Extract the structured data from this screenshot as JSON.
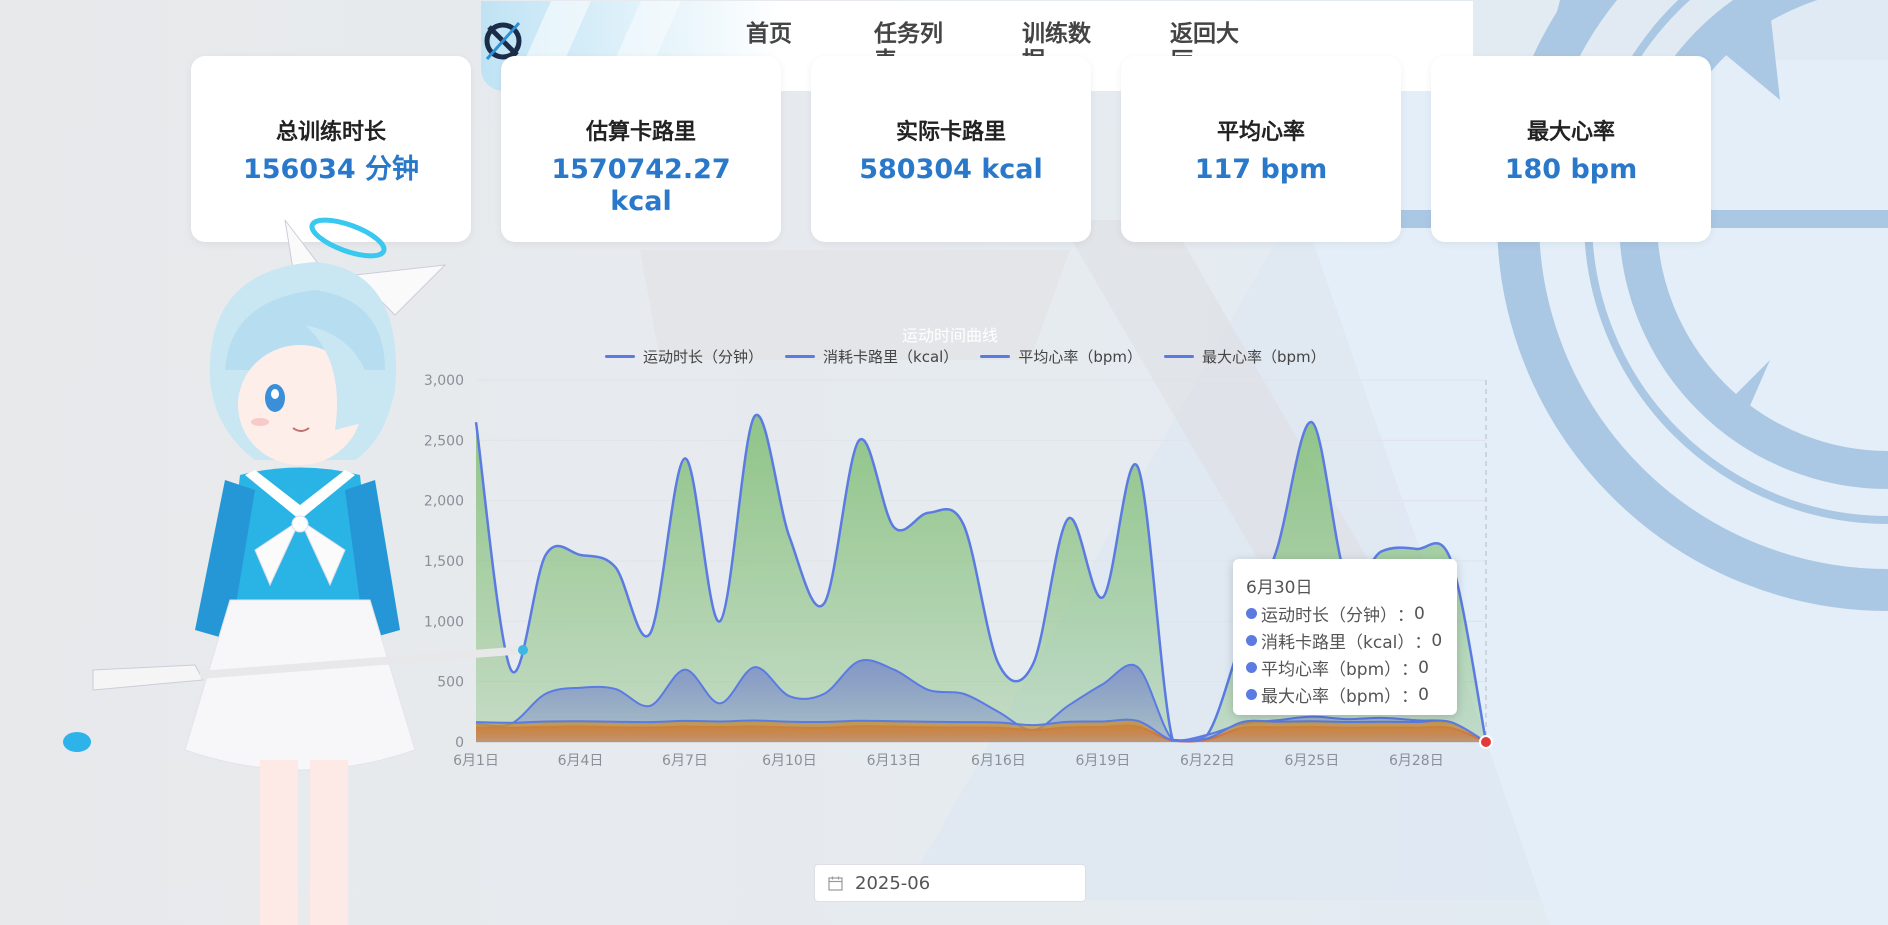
{
  "nav": {
    "items": [
      "首页",
      "任务列表",
      "训练数据",
      "返回大厅"
    ]
  },
  "stats": [
    {
      "title": "总训练时长",
      "value": "156034 分钟"
    },
    {
      "title": "估算卡路里",
      "value": "1570742.27 kcal"
    },
    {
      "title": "实际卡路里",
      "value": "580304 kcal"
    },
    {
      "title": "平均心率",
      "value": "117 bpm"
    },
    {
      "title": "最大心率",
      "value": "180 bpm"
    }
  ],
  "chart_data": {
    "type": "area",
    "title": "运动时间曲线",
    "legend_position": "top",
    "x_ticks": [
      "6月1日",
      "6月4日",
      "6月7日",
      "6月10日",
      "6月13日",
      "6月16日",
      "6月19日",
      "6月22日",
      "6月25日",
      "6月28日"
    ],
    "ylim": [
      0,
      3000
    ],
    "y_ticks": [
      "0",
      "500",
      "1,000",
      "1,500",
      "2,000",
      "2,500",
      "3,000"
    ],
    "x": [
      1,
      2,
      3,
      4,
      5,
      6,
      7,
      8,
      9,
      10,
      11,
      12,
      13,
      14,
      15,
      16,
      17,
      18,
      19,
      20,
      21,
      22,
      23,
      24,
      25,
      26,
      27,
      28,
      29,
      30
    ],
    "series": [
      {
        "name": "运动时长（分钟）",
        "color": "#5b7be3",
        "fill": "#86c07c",
        "values": [
          2650,
          600,
          1550,
          1550,
          1450,
          900,
          2350,
          1000,
          2700,
          1700,
          1150,
          2500,
          1780,
          1900,
          1800,
          650,
          650,
          1850,
          1200,
          2280,
          20,
          60,
          860,
          1600,
          2650,
          1350,
          1580,
          1600,
          1500,
          0
        ]
      },
      {
        "name": "消耗卡路里（kcal）",
        "color": "#5b7be3",
        "fill": "#7d8fc9",
        "values": [
          150,
          150,
          400,
          450,
          440,
          300,
          600,
          320,
          620,
          380,
          400,
          670,
          600,
          430,
          400,
          250,
          100,
          300,
          480,
          620,
          20,
          60,
          150,
          180,
          210,
          190,
          200,
          180,
          160,
          0
        ]
      },
      {
        "name": "平均心率（bpm）",
        "color": "#d9593f",
        "fill": "#d9593f",
        "values": [
          120,
          118,
          125,
          130,
          122,
          120,
          128,
          125,
          130,
          121,
          118,
          132,
          128,
          122,
          120,
          118,
          100,
          121,
          125,
          130,
          10,
          20,
          118,
          122,
          125,
          119,
          121,
          120,
          117,
          0
        ]
      },
      {
        "name": "最大心率（bpm）",
        "color": "#5b7be3",
        "fill": "#c8913a",
        "values": [
          165,
          160,
          170,
          172,
          168,
          165,
          175,
          170,
          178,
          168,
          166,
          176,
          172,
          168,
          165,
          162,
          140,
          168,
          170,
          175,
          15,
          30,
          165,
          168,
          172,
          166,
          168,
          166,
          164,
          0
        ]
      }
    ]
  },
  "tooltip": {
    "title": "6月30日",
    "rows": [
      {
        "label": "运动时长（分钟）",
        "value": "0"
      },
      {
        "label": "消耗卡路里（kcal）",
        "value": "0"
      },
      {
        "label": "平均心率（bpm）",
        "value": "0"
      },
      {
        "label": "最大心率（bpm）",
        "value": "0"
      }
    ]
  },
  "date_picker": {
    "value": "2025-06",
    "icon": "calendar-icon"
  }
}
